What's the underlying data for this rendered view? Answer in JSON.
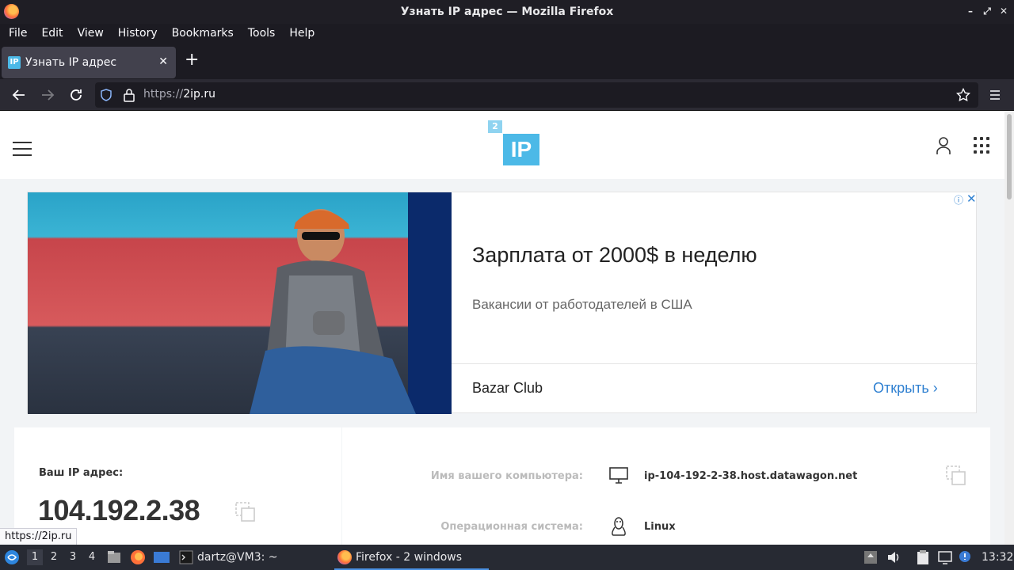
{
  "window": {
    "title": "Узнать IP адрес — Mozilla Firefox",
    "min": "–",
    "max": "⤢",
    "close": "✕"
  },
  "menu": [
    "File",
    "Edit",
    "View",
    "History",
    "Bookmarks",
    "Tools",
    "Help"
  ],
  "tab": {
    "favicon_text": "IP",
    "title": "Узнать IP адрес",
    "close": "✕",
    "new": "+"
  },
  "nav": {
    "url_scheme": "https://",
    "url_host": "2ip.ru"
  },
  "site": {
    "logo_small": "2",
    "logo_big": "IP"
  },
  "ad": {
    "title": "Зарплата от 2000$ в неделю",
    "subtitle": "Вакансии от работодателей в США",
    "brand": "Bazar Club",
    "cta": "Открыть",
    "cta_arrow": "›",
    "info": "ⓘ",
    "close": "✕"
  },
  "ip_card": {
    "label": "Ваш IP адрес:",
    "value": "104.192.2.38"
  },
  "info_rows": [
    {
      "label": "Имя вашего компьютера:",
      "value": "ip-104-192-2-38.host.datawagon.net",
      "icon": "monitor-icon"
    },
    {
      "label": "Операционная система:",
      "value": "Linux",
      "icon": "linux-icon"
    }
  ],
  "status_url": "https://2ip.ru",
  "taskbar": {
    "workspaces": [
      "1",
      "2",
      "3",
      "4"
    ],
    "terminal": "dartz@VM3: ~",
    "firefox": "Firefox - 2 windows",
    "clock": "13:32"
  }
}
